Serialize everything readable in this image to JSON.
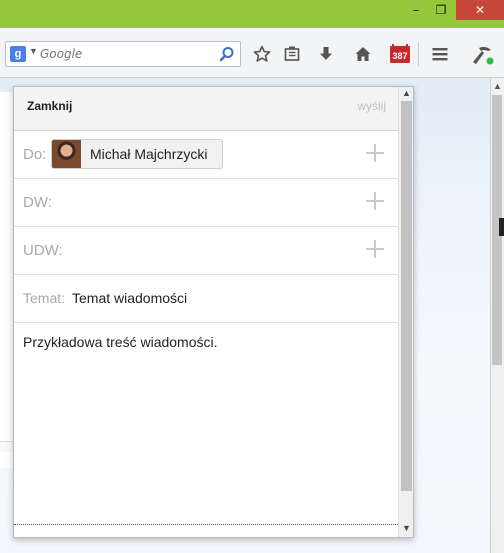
{
  "window": {
    "min_label": "–",
    "restore_label": "❐",
    "close_label": "✕"
  },
  "toolbar": {
    "search_engine_letter": "g",
    "search_placeholder": "Google",
    "badge_count": "387",
    "icons": [
      "search-engine-icon",
      "search-go-icon",
      "bookmark-star-icon",
      "reading-list-icon",
      "download-icon",
      "home-icon",
      "calendar-icon",
      "menu-icon",
      "addon-icon"
    ]
  },
  "compose": {
    "close_label": "Zamknij",
    "send_label": "wyślij",
    "to_label": "Do:",
    "recipient_name": "Michał Majchrzycki",
    "cc_label": "DW:",
    "bcc_label": "UDW:",
    "subject_label": "Temat:",
    "subject_value": "Temat wiadomości",
    "body_text": "Przykładowa treść wiadomości."
  },
  "colors": {
    "titlebar": "#95c73a",
    "close_button": "#c7463a",
    "badge": "#c42a2a"
  }
}
